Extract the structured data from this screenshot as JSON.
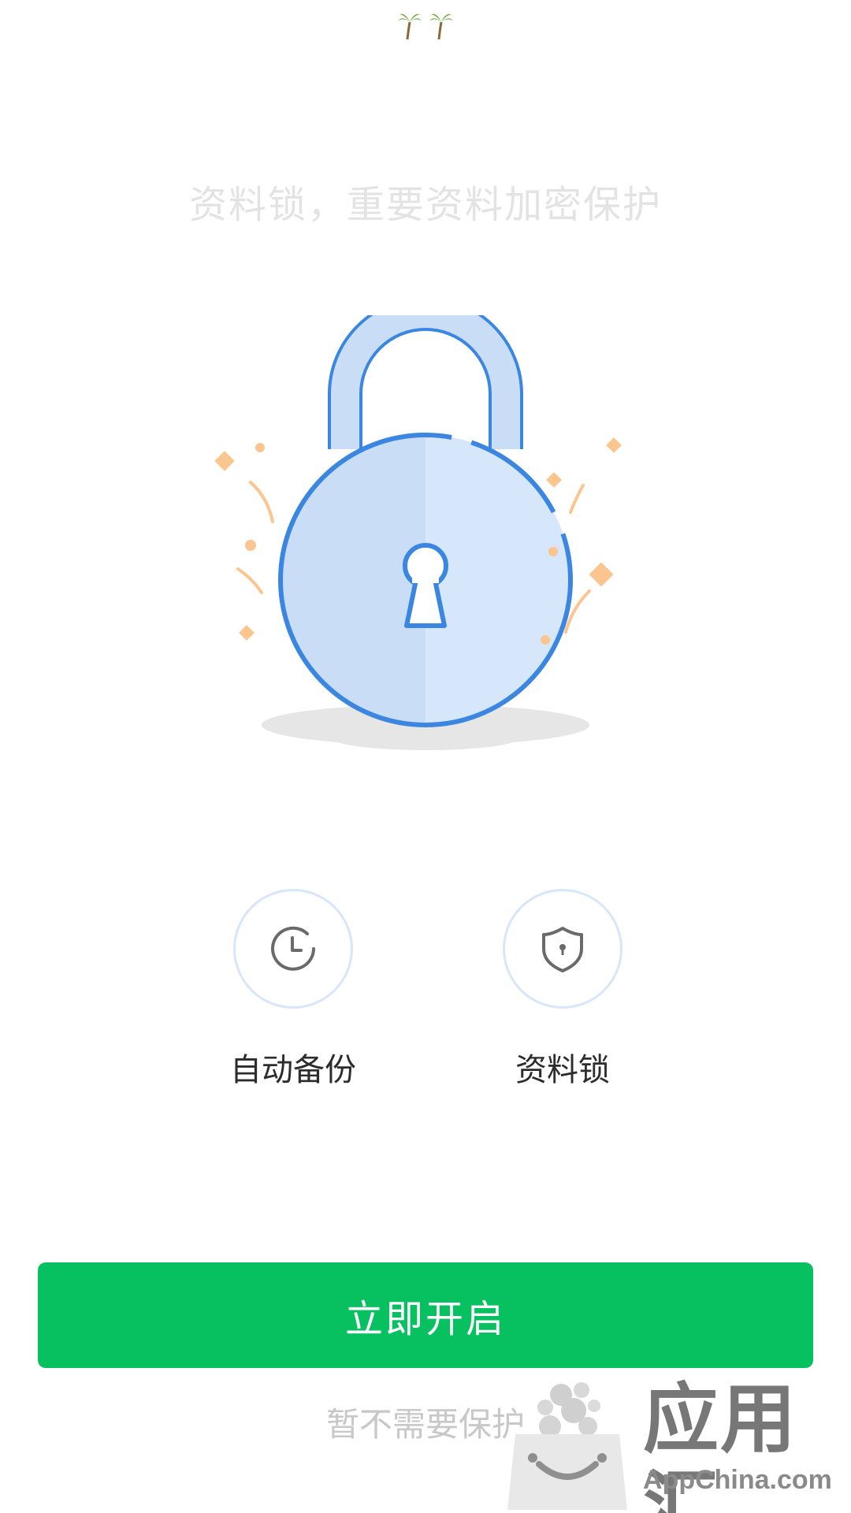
{
  "status_bar": {
    "emoji": "🌴🌴"
  },
  "headline": "资料锁，重要资料加密保护",
  "hero": {
    "icon": "padlock-illustration",
    "colors": {
      "lock_fill": "#c9ddf7",
      "lock_stroke": "#3a86e0",
      "confetti": "#fbc58f",
      "shadow": "#e4e4e4"
    }
  },
  "features": [
    {
      "label": "自动备份",
      "icon": "clock-icon"
    },
    {
      "label": "资料锁",
      "icon": "shield-lock-icon"
    }
  ],
  "primary_button": {
    "label": "立即开启",
    "color": "#07c160"
  },
  "secondary_link": {
    "label": "暂不需要保护"
  },
  "watermark": {
    "cn": "应用汇",
    "en": "AppChina.com"
  }
}
